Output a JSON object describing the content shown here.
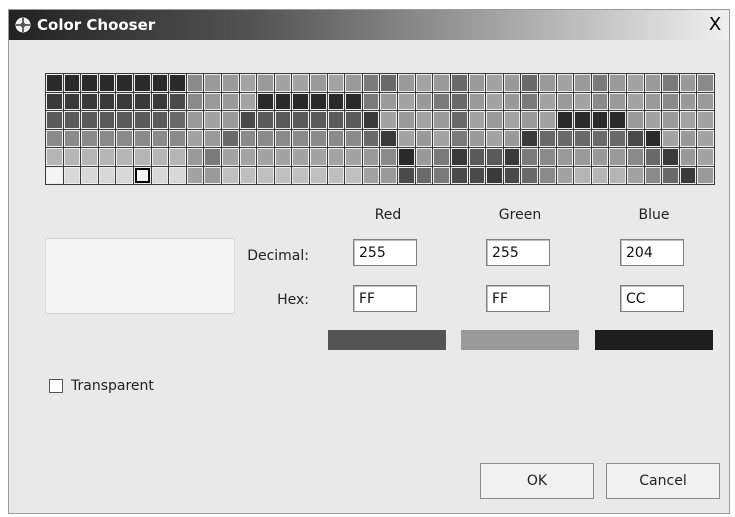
{
  "dialog": {
    "title": "Color Chooser",
    "close_label": "X"
  },
  "palette": {
    "rows": [
      [
        "#2a2a2a",
        "#2a2a2a",
        "#2a2a2a",
        "#2a2a2a",
        "#2a2a2a",
        "#2a2a2a",
        "#2a2a2a",
        "#2a2a2a",
        "#8a8a8a",
        "#9a9a9a",
        "#9a9a9a",
        "#a3a3a3",
        "#9a9a9a",
        "#a3a3a3",
        "#a3a3a3",
        "#9a9a9a",
        "#a3a3a3",
        "#9a9a9a",
        "#7a7a7a",
        "#6a6a6a",
        "#9a9a9a",
        "#a3a3a3",
        "#9a9a9a",
        "#6a6a6a",
        "#9a9a9a",
        "#a3a3a3",
        "#9a9a9a",
        "#6a6a6a",
        "#9a9a9a",
        "#a3a3a3",
        "#9a9a9a",
        "#7a7a7a",
        "#9a9a9a",
        "#a3a3a3",
        "#9a9a9a",
        "#7a7a7a",
        "#9a9a9a",
        "#8a8a8a"
      ],
      [
        "#3a3a3a",
        "#3a3a3a",
        "#3a3a3a",
        "#3a3a3a",
        "#3a3a3a",
        "#3a3a3a",
        "#3a3a3a",
        "#4a4a4a",
        "#8a8a8a",
        "#9a9a9a",
        "#9a9a9a",
        "#a3a3a3",
        "#2a2a2a",
        "#2a2a2a",
        "#2a2a2a",
        "#2a2a2a",
        "#2a2a2a",
        "#2a2a2a",
        "#7a7a7a",
        "#9a9a9a",
        "#a3a3a3",
        "#9a9a9a",
        "#7a7a7a",
        "#6a6a6a",
        "#9a9a9a",
        "#a3a3a3",
        "#9a9a9a",
        "#7a7a7a",
        "#a3a3a3",
        "#9a9a9a",
        "#a3a3a3",
        "#8a8a8a",
        "#9a9a9a",
        "#a3a3a3",
        "#9a9a9a",
        "#8a8a8a",
        "#9a9a9a",
        "#9a9a9a"
      ],
      [
        "#5a5a5a",
        "#5a5a5a",
        "#5a5a5a",
        "#5a5a5a",
        "#5a5a5a",
        "#5a5a5a",
        "#5a5a5a",
        "#6a6a6a",
        "#9a9a9a",
        "#a3a3a3",
        "#9a9a9a",
        "#4a4a4a",
        "#5a5a5a",
        "#5a5a5a",
        "#5a5a5a",
        "#5a5a5a",
        "#5a5a5a",
        "#5a5a5a",
        "#3a3a3a",
        "#a3a3a3",
        "#9a9a9a",
        "#a3a3a3",
        "#9a9a9a",
        "#6a6a6a",
        "#a3a3a3",
        "#9a9a9a",
        "#a3a3a3",
        "#9a9a9a",
        "#a3a3a3",
        "#2a2a2a",
        "#2a2a2a",
        "#2a2a2a",
        "#2a2a2a",
        "#9a9a9a",
        "#a3a3a3",
        "#9a9a9a",
        "#a3a3a3",
        "#a3a3a3"
      ],
      [
        "#8a8a8a",
        "#8a8a8a",
        "#8a8a8a",
        "#8a8a8a",
        "#8a8a8a",
        "#8a8a8a",
        "#8a8a8a",
        "#8a8a8a",
        "#a3a3a3",
        "#9a9a9a",
        "#6a6a6a",
        "#8a8a8a",
        "#8a8a8a",
        "#8a8a8a",
        "#8a8a8a",
        "#8a8a8a",
        "#8a8a8a",
        "#8a8a8a",
        "#6a6a6a",
        "#3a3a3a",
        "#a3a3a3",
        "#9a9a9a",
        "#a3a3a3",
        "#7a7a7a",
        "#9a9a9a",
        "#a3a3a3",
        "#9a9a9a",
        "#3a3a3a",
        "#6a6a6a",
        "#6a6a6a",
        "#6a6a6a",
        "#6a6a6a",
        "#6a6a6a",
        "#4a4a4a",
        "#2a2a2a",
        "#a3a3a3",
        "#9a9a9a",
        "#a3a3a3"
      ],
      [
        "#b5b5b5",
        "#b5b5b5",
        "#b5b5b5",
        "#b5b5b5",
        "#b5b5b5",
        "#b5b5b5",
        "#b5b5b5",
        "#b5b5b5",
        "#9a9a9a",
        "#7a7a7a",
        "#a3a3a3",
        "#a3a3a3",
        "#a3a3a3",
        "#a3a3a3",
        "#a3a3a3",
        "#a3a3a3",
        "#a3a3a3",
        "#a3a3a3",
        "#9a9a9a",
        "#8a8a8a",
        "#2a2a2a",
        "#9a9a9a",
        "#7a7a7a",
        "#3a3a3a",
        "#5a5a5a",
        "#5a5a5a",
        "#3a3a3a",
        "#7a7a7a",
        "#8a8a8a",
        "#9a9a9a",
        "#9a9a9a",
        "#9a9a9a",
        "#9a9a9a",
        "#8a8a8a",
        "#6a6a6a",
        "#3a3a3a",
        "#9a9a9a",
        "#a3a3a3"
      ],
      [
        "#f4f4f4",
        "#d8d8d8",
        "#d8d8d8",
        "#d8d8d8",
        "#d8d8d8",
        "#f4f4f4",
        "#d8d8d8",
        "#d8d8d8",
        "#a3a3a3",
        "#9a9a9a",
        "#c0c0c0",
        "#c0c0c0",
        "#c0c0c0",
        "#c0c0c0",
        "#c0c0c0",
        "#c0c0c0",
        "#c0c0c0",
        "#c0c0c0",
        "#a3a3a3",
        "#9a9a9a",
        "#4a4a4a",
        "#6a6a6a",
        "#7a7a7a",
        "#4a4a4a",
        "#4a4a4a",
        "#3a3a3a",
        "#4a4a4a",
        "#6a6a6a",
        "#8a8a8a",
        "#a3a3a3",
        "#b5b5b5",
        "#b5b5b5",
        "#b5b5b5",
        "#a3a3a3",
        "#8a8a8a",
        "#6a6a6a",
        "#3a3a3a",
        "#9a9a9a"
      ]
    ],
    "selected": {
      "row": 5,
      "col": 5
    }
  },
  "preview_color": "#f4f4f4",
  "columns": {
    "red": "Red",
    "green": "Green",
    "blue": "Blue"
  },
  "rows": {
    "decimal": "Decimal:",
    "hex": "Hex:"
  },
  "values": {
    "decimal": {
      "red": "255",
      "green": "255",
      "blue": "204"
    },
    "hex": {
      "red": "FF",
      "green": "FF",
      "blue": "CC"
    }
  },
  "channel_bars": {
    "red": "#555555",
    "green": "#9a9a9a",
    "blue": "#1e1e1e"
  },
  "transparent": {
    "label": "Transparent",
    "checked": false
  },
  "buttons": {
    "ok": "OK",
    "cancel": "Cancel"
  }
}
